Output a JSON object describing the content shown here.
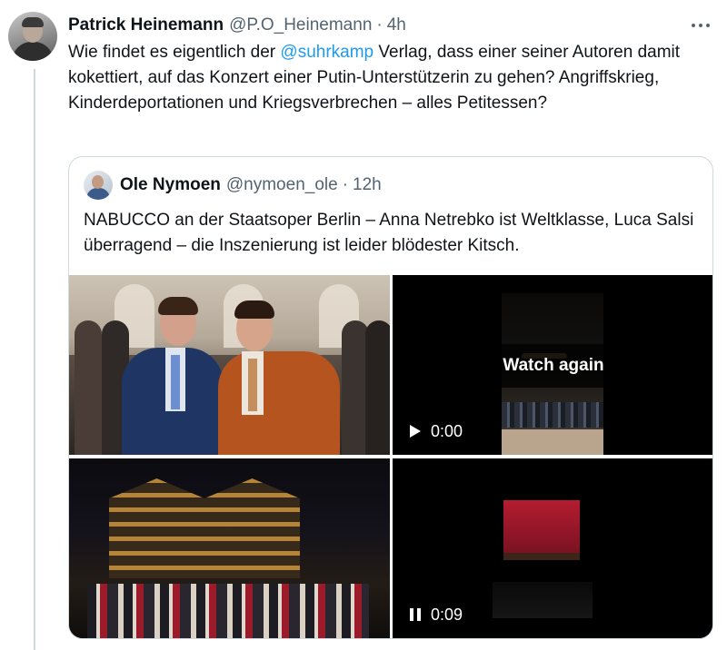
{
  "tweet": {
    "author": {
      "name": "Patrick Heinemann",
      "handle": "@P.O_Heinemann",
      "time": "4h"
    },
    "separator": "·",
    "text_before": "Wie findet es eigentlich der ",
    "mention": "@suhrkamp",
    "text_after": " Verlag, dass einer seiner Autoren damit kokettiert, auf das Konzert einer Putin-Unterstützerin zu gehen? Angriffskrieg, Kinderdeportationen und Kriegsverbrechen – alles Petitessen?",
    "more_icon": "more-horizontal-icon"
  },
  "quote": {
    "author": {
      "name": "Ole Nymoen",
      "handle": "@nymoen_ole",
      "time": "12h"
    },
    "text": "NABUCCO an der Staatsoper Berlin – Anna Netrebko ist Weltklasse, Luca Salsi überragend – die Inszenierung ist leider blödester Kitsch."
  },
  "media": {
    "video1": {
      "overlay_label": "Watch again",
      "time": "0:00",
      "control_icon": "play-icon"
    },
    "video2": {
      "time": "0:09",
      "control_icon": "pause-icon"
    }
  },
  "colors": {
    "link": "#1d9bf0",
    "secondary_text": "#536471",
    "border": "#cfd9de"
  }
}
